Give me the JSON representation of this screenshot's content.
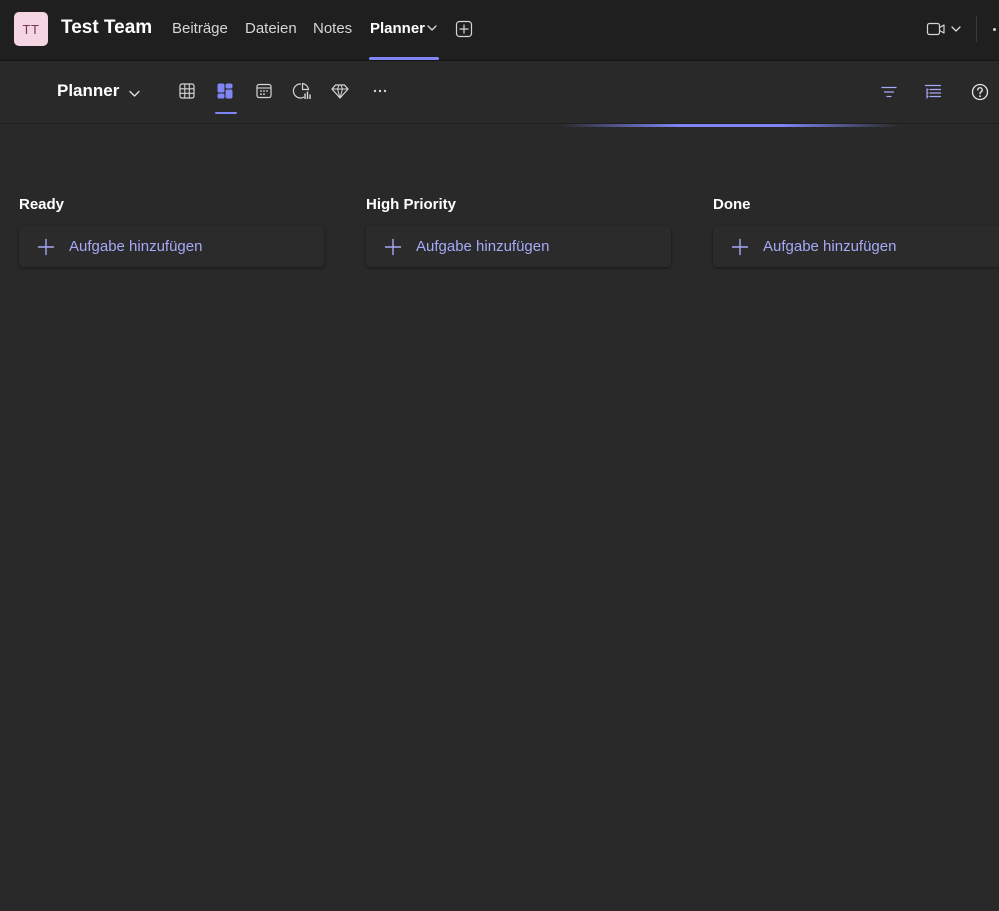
{
  "team": {
    "avatar_initials": "TT",
    "name": "Test Team"
  },
  "tabs": [
    {
      "label": "Beiträge",
      "active": false
    },
    {
      "label": "Dateien",
      "active": false
    },
    {
      "label": "Notes",
      "active": false
    },
    {
      "label": "Planner",
      "active": true
    }
  ],
  "teambar_icons": {
    "tab_menu": "chevron-down-icon",
    "add_tab": "add-tab-icon",
    "meeting": "video-camera-icon",
    "more": "more-icon"
  },
  "toolbar": {
    "plan_name": "Planner",
    "views": [
      {
        "icon": "grid-view-icon",
        "selected": false
      },
      {
        "icon": "board-view-icon",
        "selected": true
      },
      {
        "icon": "schedule-view-icon",
        "selected": false
      },
      {
        "icon": "charts-view-icon",
        "selected": false
      },
      {
        "icon": "premium-diamond-icon",
        "selected": false
      },
      {
        "icon": "more-views-icon",
        "selected": false
      }
    ],
    "right_icons": [
      "filter-icon",
      "group-by-icon",
      "help-icon"
    ]
  },
  "board": {
    "buckets": [
      {
        "title": "Ready",
        "add_task_label": "Aufgabe hinzufügen"
      },
      {
        "title": "High Priority",
        "add_task_label": "Aufgabe hinzufügen"
      },
      {
        "title": "Done",
        "add_task_label": "Aufgabe hinzufügen"
      }
    ]
  },
  "colors": {
    "accent": "#7f85f5",
    "add_task_text": "#a6a9f7",
    "background": "#292929",
    "teambar": "#1f1f1f",
    "avatar_bg": "#f5d5e2"
  }
}
